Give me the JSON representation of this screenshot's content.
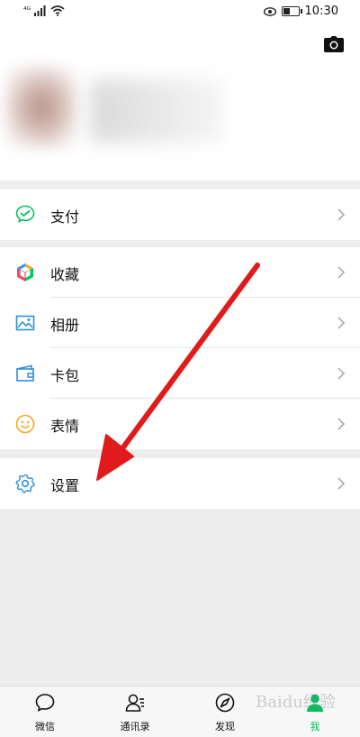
{
  "status_bar": {
    "time": "10:30",
    "signal_text": "⁴ᴳ",
    "battery_level": 0.45
  },
  "payment": {
    "label": "支付",
    "icon": "wechat-pay-icon"
  },
  "menu": [
    {
      "label": "收藏",
      "icon": "favorites-cube-icon"
    },
    {
      "label": "相册",
      "icon": "album-picture-icon"
    },
    {
      "label": "卡包",
      "icon": "card-wallet-icon"
    },
    {
      "label": "表情",
      "icon": "sticker-smile-icon"
    }
  ],
  "settings": {
    "label": "设置",
    "icon": "gear-icon"
  },
  "tabs": [
    {
      "label": "微信",
      "icon": "chat-bubble-icon",
      "active": false
    },
    {
      "label": "通讯录",
      "icon": "contacts-icon",
      "active": false
    },
    {
      "label": "发现",
      "icon": "compass-icon",
      "active": false
    },
    {
      "label": "我",
      "icon": "person-icon",
      "active": true
    }
  ],
  "colors": {
    "accent": "#07c160",
    "annotation_arrow": "#e01b1b",
    "background": "#ededed"
  },
  "watermark": "Baidu经验"
}
